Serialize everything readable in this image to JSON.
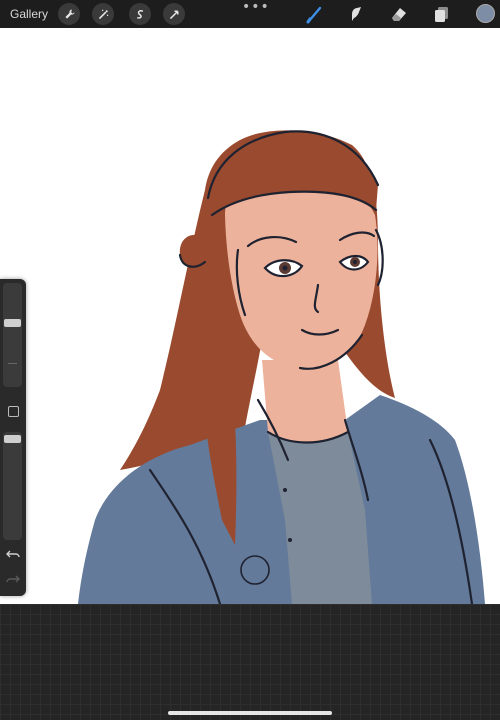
{
  "topbar": {
    "gallery_label": "Gallery",
    "left_tools": [
      "wrench-icon",
      "magic-wand-icon",
      "selection-icon",
      "transform-icon"
    ],
    "more_label": "•••",
    "right_tools": [
      "brush-icon",
      "smudge-icon",
      "eraser-icon",
      "layers-icon"
    ],
    "active_tool": "brush-icon",
    "active_tool_color": "#3d8fe8",
    "current_color": "#7d8da5"
  },
  "sidebar": {
    "brush_size_level": 0.62,
    "opacity_level": 0.97,
    "icons": [
      "modify-button",
      "undo-icon",
      "redo-icon"
    ]
  },
  "canvas": {
    "background": "#ffffff",
    "palette": {
      "hair": "#9a4a2e",
      "skin": "#edb29b",
      "shirt": "#637a9a",
      "tshirt": "#7e8b9a",
      "line": "#1f2230"
    }
  }
}
